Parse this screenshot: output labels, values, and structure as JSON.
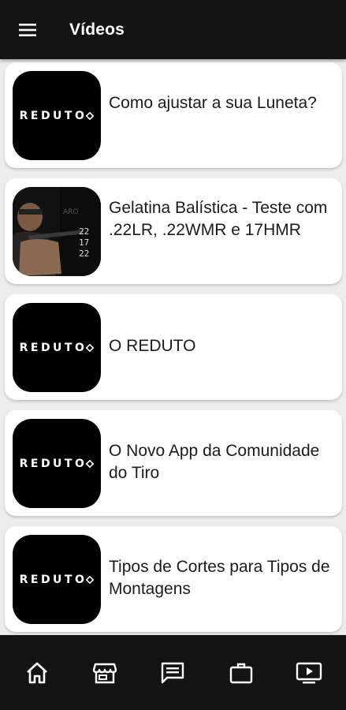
{
  "appbar": {
    "title": "Vídeos"
  },
  "videos": [
    {
      "title": "Como ajustar a sua Luneta?",
      "thumb_logo": "REDUTO",
      "thumb_type": "logo"
    },
    {
      "title": "Gelatina Balística - Teste com .22LR, .22WMR e 17HMR",
      "thumb_type": "photo"
    },
    {
      "title": "O REDUTO",
      "thumb_logo": "REDUTO",
      "thumb_type": "logo"
    },
    {
      "title": "O Novo App da Comunidade do Tiro",
      "thumb_logo": "REDUTO",
      "thumb_type": "logo"
    },
    {
      "title": "Tipos de Cortes para Tipos de Montagens",
      "thumb_logo": "REDUTO",
      "thumb_type": "logo"
    }
  ],
  "thumb_overlay_numbers": [
    "22",
    "17",
    "22"
  ],
  "bottom_nav": [
    {
      "icon": "home-icon"
    },
    {
      "icon": "store-icon"
    },
    {
      "icon": "forum-icon"
    },
    {
      "icon": "briefcase-icon"
    },
    {
      "icon": "video-icon"
    }
  ],
  "colors": {
    "bar": "#141414",
    "background": "#ececec",
    "card": "#ffffff",
    "text": "#1b1b1b"
  }
}
